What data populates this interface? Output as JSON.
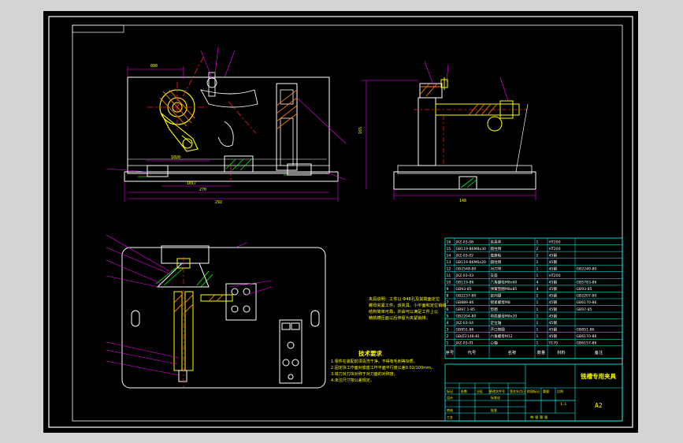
{
  "colors": {
    "background": "#000000",
    "frame": "#ffffff",
    "table_line": "#00ffff",
    "table_text": "#ffffff",
    "leader": "#ff00ff",
    "part_yellow": "#ffff00",
    "hatch_orange": "#ff7f00",
    "dimension": "#ff00ff"
  },
  "dimensions": {
    "front_top": "880",
    "front_mid": "1020",
    "front_inner": "1017",
    "front_width_1": "270",
    "front_width_2": "292",
    "side_height": "165",
    "side_width": "148"
  },
  "fixture_note": {
    "text": [
      "夹具说明：工件以 Φ48孔及其端面定位",
      "螺母夹紧工件，该夹具，小平面和定位销组",
      "结构简单可靠，并由可以满足工件上以",
      "精铣槽压面以后停留为夹紧销排。"
    ]
  },
  "tech_requirements": {
    "title": "技术要求",
    "items": [
      "1.零件在装配前须清洗干净，不得有毛刺等杂质。",
      "2.固定块工作面对底座工作平面平行度公差0.02/100mm。",
      "3.铣刀对刀块对称于对刀面的对称度。",
      "4.未注尺寸按公差规定。"
    ]
  },
  "parts_table": {
    "header": {
      "no": "序号",
      "code": "代号",
      "name": "名称",
      "qty": "数量",
      "material": "材料",
      "note": "备注"
    },
    "rows": [
      {
        "no": "16",
        "code": "JXZ-03-08",
        "name": "夹具体",
        "qty": "1",
        "material": "HT200",
        "note": ""
      },
      {
        "no": "15",
        "code": "GB119-86M8x30",
        "name": "圆柱销",
        "qty": "2",
        "material": "HT200",
        "note": ""
      },
      {
        "no": "14",
        "code": "JXZ-03-02",
        "name": "底座板",
        "qty": "2",
        "material": "45钢",
        "note": ""
      },
      {
        "no": "13",
        "code": "GB119-86M6x20",
        "name": "圆柱销",
        "qty": "2",
        "material": "45钢",
        "note": ""
      },
      {
        "no": "12",
        "code": "GB2548-80",
        "name": "对刀块",
        "qty": "1",
        "material": "45钢",
        "note": "GB2240-80"
      },
      {
        "no": "11",
        "code": "JXZ-03-03",
        "name": "支座",
        "qty": "1",
        "material": "HT200",
        "note": ""
      },
      {
        "no": "10",
        "code": "GB119-86",
        "name": "六角螺栓M8x60",
        "qty": "4",
        "material": "45钢",
        "note": "GB5783-86"
      },
      {
        "no": "9",
        "code": "GB93-85",
        "name": "弹簧垫圈M8x85",
        "qty": "4",
        "material": "45钢",
        "note": "GB93-85"
      },
      {
        "no": "8",
        "code": "GB2237-80",
        "name": "定向键",
        "qty": "2",
        "material": "45钢",
        "note": "GB2207-80"
      },
      {
        "no": "7",
        "code": "GB889-86",
        "name": "锁紧螺母M8",
        "qty": "1",
        "material": "45钢",
        "note": "GB6170-86"
      },
      {
        "no": "6",
        "code": "GB97.1-85",
        "name": "垫圈",
        "qty": "1",
        "material": "45钢",
        "note": "GB97-85"
      },
      {
        "no": "5",
        "code": "GB2204-80",
        "name": "带肩螺母M8x20",
        "qty": "1",
        "material": "45钢",
        "note": ""
      },
      {
        "no": "4",
        "code": "JXZ-03-04",
        "name": "定位轴",
        "qty": "1",
        "material": "45钢",
        "note": ""
      },
      {
        "no": "3",
        "code": "GB851-86",
        "name": "开口垫圈",
        "qty": "1",
        "material": "45钢",
        "note": "GB851-86"
      },
      {
        "no": "2",
        "code": "GB/Z2148-81",
        "name": "六角螺母M12",
        "qty": "1",
        "material": "45钢",
        "note": "GB6170-86"
      },
      {
        "no": "1",
        "code": "JXZ-03-01",
        "name": "心轴",
        "qty": "1",
        "material": "Y170",
        "note": "GB6157-86"
      }
    ]
  },
  "title_block": {
    "drawing_title": "铣槽专用夹具",
    "sheet_size": "A2",
    "row_labels": [
      "标记",
      "处数",
      "分区",
      "更改文件号",
      "签名",
      "年月日"
    ],
    "designer": "设计",
    "std": "标准化",
    "checker": "审核",
    "process": "工艺",
    "approve": "批准",
    "stage": "阶段标记",
    "weight": "重量",
    "scale": "比例",
    "scale_val": "1:1",
    "sheets": "共 张 第 张"
  }
}
